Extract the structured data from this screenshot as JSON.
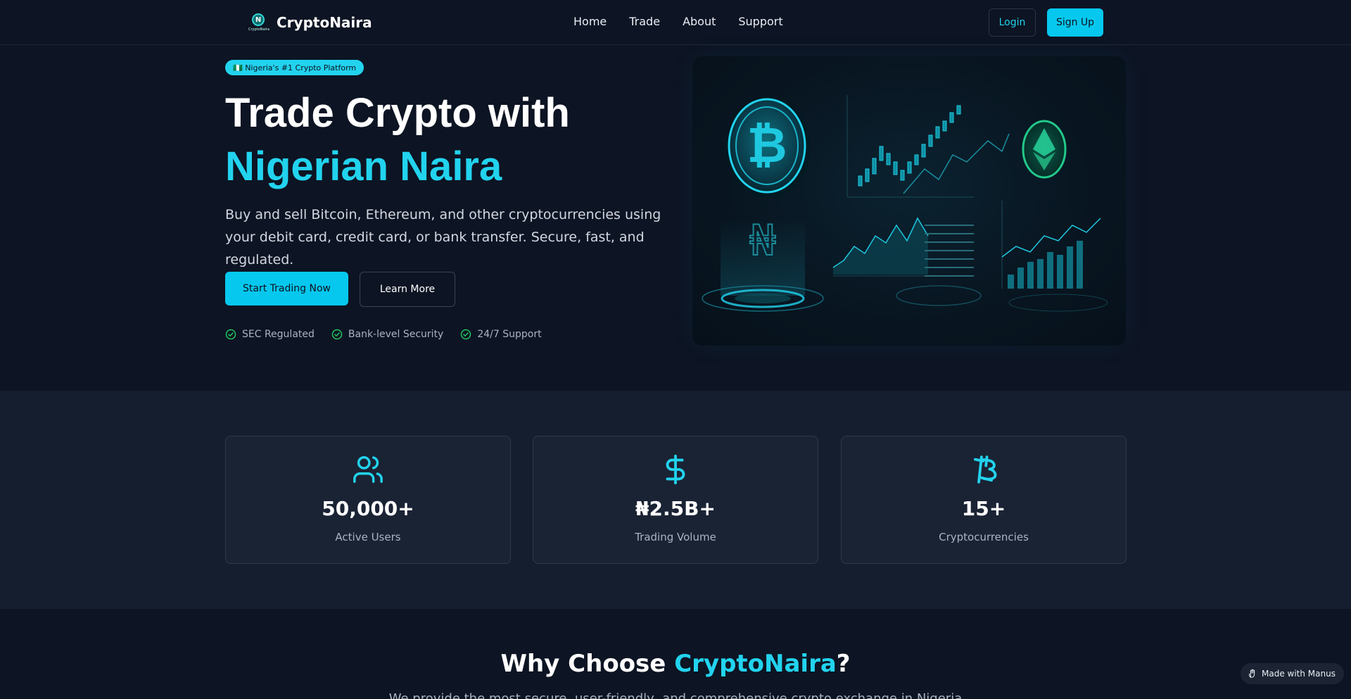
{
  "nav": {
    "brand": "CryptoNaira",
    "logo_letter": "N",
    "logo_caption": "CryptoNaira",
    "links": [
      "Home",
      "Trade",
      "About",
      "Support"
    ],
    "login": "Login",
    "signup": "Sign Up"
  },
  "hero": {
    "badge": "🇳🇬 Nigeria's #1 Crypto Platform",
    "title_line1": "Trade Crypto with",
    "title_line2": "Nigerian Naira",
    "lead": "Buy and sell Bitcoin, Ethereum, and other cryptocurrencies using your debit card, credit card, or bank transfer. Secure, fast, and regulated.",
    "cta_primary": "Start Trading Now",
    "cta_secondary": "Learn More",
    "checks": [
      "SEC Regulated",
      "Bank-level Security",
      "24/7 Support"
    ]
  },
  "stats": [
    {
      "icon": "users-icon",
      "value": "50,000+",
      "label": "Active Users"
    },
    {
      "icon": "dollar-icon",
      "value": "₦2.5B+",
      "label": "Trading Volume"
    },
    {
      "icon": "bitcoin-icon",
      "value": "15+",
      "label": "Cryptocurrencies"
    }
  ],
  "why": {
    "title_pre": "Why Choose ",
    "title_accent": "CryptoNaira",
    "title_post": "?",
    "subtitle": "We provide the most secure, user-friendly, and comprehensive crypto exchange in Nigeria"
  },
  "badge_made_with": "Made with Manus",
  "colors": {
    "accent": "#22d3ee",
    "bg": "#0d1423",
    "card": "#1a2334"
  }
}
